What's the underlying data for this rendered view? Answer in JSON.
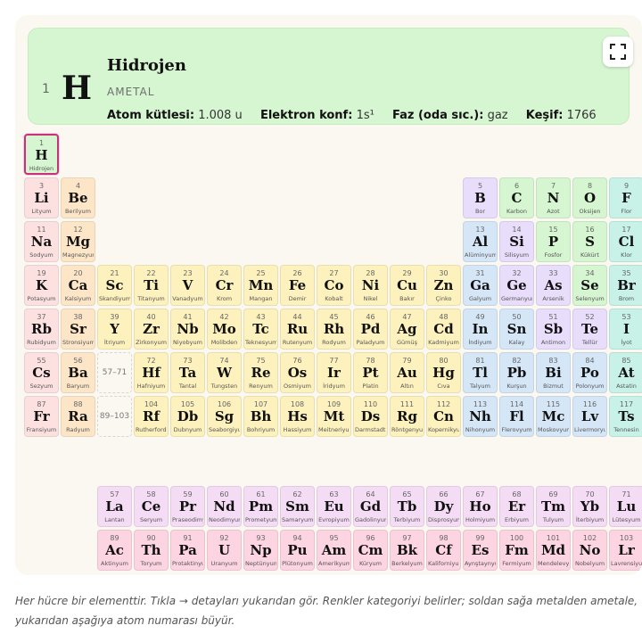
{
  "detail": {
    "number": "1",
    "symbol": "H",
    "name": "Hidrojen",
    "category": "AMETAL",
    "props": [
      {
        "label": "Atom kütlesi:",
        "value": "1.008 u"
      },
      {
        "label": "Elektron konf:",
        "value": "1s¹"
      },
      {
        "label": "Faz (oda sıc.):",
        "value": "gaz"
      },
      {
        "label": "Keşif:",
        "value": "1766"
      }
    ]
  },
  "colors": {
    "nonmetal": "#d6f5d1",
    "alkali": "#fde1e1",
    "alkaline": "#fde6c8",
    "transition": "#fdf1bd",
    "metalloid": "#e8ddfa",
    "post_transition": "#d5e6f7",
    "halogen": "#c8f2e8",
    "lanthanide": "#f5dcf5",
    "actinide": "#fcd4e2",
    "noble": "#ffe6c8"
  },
  "placeholders": {
    "lanthanides": "57–71",
    "actinides": "89–103"
  },
  "elements": [
    {
      "n": "1",
      "s": "H",
      "name": "Hidrojen",
      "cat": "nonmetal",
      "row": 1,
      "col": 1,
      "selected": true
    },
    {
      "n": "3",
      "s": "Li",
      "name": "Lityum",
      "cat": "alkali",
      "row": 2,
      "col": 1
    },
    {
      "n": "4",
      "s": "Be",
      "name": "Berilyum",
      "cat": "alkaline",
      "row": 2,
      "col": 2
    },
    {
      "n": "5",
      "s": "B",
      "name": "Bor",
      "cat": "metalloid",
      "row": 2,
      "col": 13
    },
    {
      "n": "6",
      "s": "C",
      "name": "Karbon",
      "cat": "nonmetal",
      "row": 2,
      "col": 14
    },
    {
      "n": "7",
      "s": "N",
      "name": "Azot",
      "cat": "nonmetal",
      "row": 2,
      "col": 15
    },
    {
      "n": "8",
      "s": "O",
      "name": "Oksijen",
      "cat": "nonmetal",
      "row": 2,
      "col": 16
    },
    {
      "n": "9",
      "s": "F",
      "name": "Flor",
      "cat": "halogen",
      "row": 2,
      "col": 17
    },
    {
      "n": "11",
      "s": "Na",
      "name": "Sodyum",
      "cat": "alkali",
      "row": 3,
      "col": 1
    },
    {
      "n": "12",
      "s": "Mg",
      "name": "Magnezyum",
      "cat": "alkaline",
      "row": 3,
      "col": 2
    },
    {
      "n": "13",
      "s": "Al",
      "name": "Alüminyum",
      "cat": "post_transition",
      "row": 3,
      "col": 13
    },
    {
      "n": "14",
      "s": "Si",
      "name": "Silisyum",
      "cat": "metalloid",
      "row": 3,
      "col": 14
    },
    {
      "n": "15",
      "s": "P",
      "name": "Fosfor",
      "cat": "nonmetal",
      "row": 3,
      "col": 15
    },
    {
      "n": "16",
      "s": "S",
      "name": "Kükürt",
      "cat": "nonmetal",
      "row": 3,
      "col": 16
    },
    {
      "n": "17",
      "s": "Cl",
      "name": "Klor",
      "cat": "halogen",
      "row": 3,
      "col": 17
    },
    {
      "n": "19",
      "s": "K",
      "name": "Potasyum",
      "cat": "alkali",
      "row": 4,
      "col": 1
    },
    {
      "n": "20",
      "s": "Ca",
      "name": "Kalsiyum",
      "cat": "alkaline",
      "row": 4,
      "col": 2
    },
    {
      "n": "21",
      "s": "Sc",
      "name": "Skandiyum",
      "cat": "transition",
      "row": 4,
      "col": 3
    },
    {
      "n": "22",
      "s": "Ti",
      "name": "Titanyum",
      "cat": "transition",
      "row": 4,
      "col": 4
    },
    {
      "n": "23",
      "s": "V",
      "name": "Vanadyum",
      "cat": "transition",
      "row": 4,
      "col": 5
    },
    {
      "n": "24",
      "s": "Cr",
      "name": "Krom",
      "cat": "transition",
      "row": 4,
      "col": 6
    },
    {
      "n": "25",
      "s": "Mn",
      "name": "Mangan",
      "cat": "transition",
      "row": 4,
      "col": 7
    },
    {
      "n": "26",
      "s": "Fe",
      "name": "Demir",
      "cat": "transition",
      "row": 4,
      "col": 8
    },
    {
      "n": "27",
      "s": "Co",
      "name": "Kobalt",
      "cat": "transition",
      "row": 4,
      "col": 9
    },
    {
      "n": "28",
      "s": "Ni",
      "name": "Nikel",
      "cat": "transition",
      "row": 4,
      "col": 10
    },
    {
      "n": "29",
      "s": "Cu",
      "name": "Bakır",
      "cat": "transition",
      "row": 4,
      "col": 11
    },
    {
      "n": "30",
      "s": "Zn",
      "name": "Çinko",
      "cat": "transition",
      "row": 4,
      "col": 12
    },
    {
      "n": "31",
      "s": "Ga",
      "name": "Galyum",
      "cat": "post_transition",
      "row": 4,
      "col": 13
    },
    {
      "n": "32",
      "s": "Ge",
      "name": "Germanyum",
      "cat": "metalloid",
      "row": 4,
      "col": 14
    },
    {
      "n": "33",
      "s": "As",
      "name": "Arsenik",
      "cat": "metalloid",
      "row": 4,
      "col": 15
    },
    {
      "n": "34",
      "s": "Se",
      "name": "Selenyum",
      "cat": "nonmetal",
      "row": 4,
      "col": 16
    },
    {
      "n": "35",
      "s": "Br",
      "name": "Brom",
      "cat": "halogen",
      "row": 4,
      "col": 17
    },
    {
      "n": "37",
      "s": "Rb",
      "name": "Rubidyum",
      "cat": "alkali",
      "row": 5,
      "col": 1
    },
    {
      "n": "38",
      "s": "Sr",
      "name": "Stronsiyum",
      "cat": "alkaline",
      "row": 5,
      "col": 2
    },
    {
      "n": "39",
      "s": "Y",
      "name": "İtriyum",
      "cat": "transition",
      "row": 5,
      "col": 3
    },
    {
      "n": "40",
      "s": "Zr",
      "name": "Zirkonyum",
      "cat": "transition",
      "row": 5,
      "col": 4
    },
    {
      "n": "41",
      "s": "Nb",
      "name": "Niyobyum",
      "cat": "transition",
      "row": 5,
      "col": 5
    },
    {
      "n": "42",
      "s": "Mo",
      "name": "Molibden",
      "cat": "transition",
      "row": 5,
      "col": 6
    },
    {
      "n": "43",
      "s": "Tc",
      "name": "Teknesyum",
      "cat": "transition",
      "row": 5,
      "col": 7
    },
    {
      "n": "44",
      "s": "Ru",
      "name": "Rutenyum",
      "cat": "transition",
      "row": 5,
      "col": 8
    },
    {
      "n": "45",
      "s": "Rh",
      "name": "Rodyum",
      "cat": "transition",
      "row": 5,
      "col": 9
    },
    {
      "n": "46",
      "s": "Pd",
      "name": "Paladyum",
      "cat": "transition",
      "row": 5,
      "col": 10
    },
    {
      "n": "47",
      "s": "Ag",
      "name": "Gümüş",
      "cat": "transition",
      "row": 5,
      "col": 11
    },
    {
      "n": "48",
      "s": "Cd",
      "name": "Kadmiyum",
      "cat": "transition",
      "row": 5,
      "col": 12
    },
    {
      "n": "49",
      "s": "In",
      "name": "İndiyum",
      "cat": "post_transition",
      "row": 5,
      "col": 13
    },
    {
      "n": "50",
      "s": "Sn",
      "name": "Kalay",
      "cat": "post_transition",
      "row": 5,
      "col": 14
    },
    {
      "n": "51",
      "s": "Sb",
      "name": "Antimon",
      "cat": "metalloid",
      "row": 5,
      "col": 15
    },
    {
      "n": "52",
      "s": "Te",
      "name": "Tellür",
      "cat": "metalloid",
      "row": 5,
      "col": 16
    },
    {
      "n": "53",
      "s": "I",
      "name": "İyot",
      "cat": "halogen",
      "row": 5,
      "col": 17
    },
    {
      "n": "55",
      "s": "Cs",
      "name": "Sezyum",
      "cat": "alkali",
      "row": 6,
      "col": 1
    },
    {
      "n": "56",
      "s": "Ba",
      "name": "Baryum",
      "cat": "alkaline",
      "row": 6,
      "col": 2
    },
    {
      "n": "72",
      "s": "Hf",
      "name": "Hafniyum",
      "cat": "transition",
      "row": 6,
      "col": 4
    },
    {
      "n": "73",
      "s": "Ta",
      "name": "Tantal",
      "cat": "transition",
      "row": 6,
      "col": 5
    },
    {
      "n": "74",
      "s": "W",
      "name": "Tungsten",
      "cat": "transition",
      "row": 6,
      "col": 6
    },
    {
      "n": "75",
      "s": "Re",
      "name": "Renyum",
      "cat": "transition",
      "row": 6,
      "col": 7
    },
    {
      "n": "76",
      "s": "Os",
      "name": "Osmiyum",
      "cat": "transition",
      "row": 6,
      "col": 8
    },
    {
      "n": "77",
      "s": "Ir",
      "name": "İridyum",
      "cat": "transition",
      "row": 6,
      "col": 9
    },
    {
      "n": "78",
      "s": "Pt",
      "name": "Platin",
      "cat": "transition",
      "row": 6,
      "col": 10
    },
    {
      "n": "79",
      "s": "Au",
      "name": "Altın",
      "cat": "transition",
      "row": 6,
      "col": 11
    },
    {
      "n": "80",
      "s": "Hg",
      "name": "Cıva",
      "cat": "transition",
      "row": 6,
      "col": 12
    },
    {
      "n": "81",
      "s": "Tl",
      "name": "Talyum",
      "cat": "post_transition",
      "row": 6,
      "col": 13
    },
    {
      "n": "82",
      "s": "Pb",
      "name": "Kurşun",
      "cat": "post_transition",
      "row": 6,
      "col": 14
    },
    {
      "n": "83",
      "s": "Bi",
      "name": "Bizmut",
      "cat": "post_transition",
      "row": 6,
      "col": 15
    },
    {
      "n": "84",
      "s": "Po",
      "name": "Polonyum",
      "cat": "post_transition",
      "row": 6,
      "col": 16
    },
    {
      "n": "85",
      "s": "At",
      "name": "Astatin",
      "cat": "halogen",
      "row": 6,
      "col": 17
    },
    {
      "n": "87",
      "s": "Fr",
      "name": "Fransiyum",
      "cat": "alkali",
      "row": 7,
      "col": 1
    },
    {
      "n": "88",
      "s": "Ra",
      "name": "Radyum",
      "cat": "alkaline",
      "row": 7,
      "col": 2
    },
    {
      "n": "104",
      "s": "Rf",
      "name": "Rutherfordiyum",
      "cat": "transition",
      "row": 7,
      "col": 4
    },
    {
      "n": "105",
      "s": "Db",
      "name": "Dubnyum",
      "cat": "transition",
      "row": 7,
      "col": 5
    },
    {
      "n": "106",
      "s": "Sg",
      "name": "Seaborgiyum",
      "cat": "transition",
      "row": 7,
      "col": 6
    },
    {
      "n": "107",
      "s": "Bh",
      "name": "Bohriyum",
      "cat": "transition",
      "row": 7,
      "col": 7
    },
    {
      "n": "108",
      "s": "Hs",
      "name": "Hassiyum",
      "cat": "transition",
      "row": 7,
      "col": 8
    },
    {
      "n": "109",
      "s": "Mt",
      "name": "Meitneriyum",
      "cat": "transition",
      "row": 7,
      "col": 9
    },
    {
      "n": "110",
      "s": "Ds",
      "name": "Darmstadtiyum",
      "cat": "transition",
      "row": 7,
      "col": 10
    },
    {
      "n": "111",
      "s": "Rg",
      "name": "Röntgenyum",
      "cat": "transition",
      "row": 7,
      "col": 11
    },
    {
      "n": "112",
      "s": "Cn",
      "name": "Kopernikyum",
      "cat": "transition",
      "row": 7,
      "col": 12
    },
    {
      "n": "113",
      "s": "Nh",
      "name": "Nihonyum",
      "cat": "post_transition",
      "row": 7,
      "col": 13
    },
    {
      "n": "114",
      "s": "Fl",
      "name": "Flerovyum",
      "cat": "post_transition",
      "row": 7,
      "col": 14
    },
    {
      "n": "115",
      "s": "Mc",
      "name": "Moskovyum",
      "cat": "post_transition",
      "row": 7,
      "col": 15
    },
    {
      "n": "116",
      "s": "Lv",
      "name": "Livermoryum",
      "cat": "post_transition",
      "row": 7,
      "col": 16
    },
    {
      "n": "117",
      "s": "Ts",
      "name": "Tennesin",
      "cat": "halogen",
      "row": 7,
      "col": 17
    },
    {
      "n": "57",
      "s": "La",
      "name": "Lantan",
      "cat": "lanthanide",
      "row": 9,
      "col": 3
    },
    {
      "n": "58",
      "s": "Ce",
      "name": "Seryum",
      "cat": "lanthanide",
      "row": 9,
      "col": 4
    },
    {
      "n": "59",
      "s": "Pr",
      "name": "Praseodimyum",
      "cat": "lanthanide",
      "row": 9,
      "col": 5
    },
    {
      "n": "60",
      "s": "Nd",
      "name": "Neodimyum",
      "cat": "lanthanide",
      "row": 9,
      "col": 6
    },
    {
      "n": "61",
      "s": "Pm",
      "name": "Prometyum",
      "cat": "lanthanide",
      "row": 9,
      "col": 7
    },
    {
      "n": "62",
      "s": "Sm",
      "name": "Samaryum",
      "cat": "lanthanide",
      "row": 9,
      "col": 8
    },
    {
      "n": "63",
      "s": "Eu",
      "name": "Evropiyum",
      "cat": "lanthanide",
      "row": 9,
      "col": 9
    },
    {
      "n": "64",
      "s": "Gd",
      "name": "Gadolinyum",
      "cat": "lanthanide",
      "row": 9,
      "col": 10
    },
    {
      "n": "65",
      "s": "Tb",
      "name": "Terbiyum",
      "cat": "lanthanide",
      "row": 9,
      "col": 11
    },
    {
      "n": "66",
      "s": "Dy",
      "name": "Disprosyum",
      "cat": "lanthanide",
      "row": 9,
      "col": 12
    },
    {
      "n": "67",
      "s": "Ho",
      "name": "Holmiyum",
      "cat": "lanthanide",
      "row": 9,
      "col": 13
    },
    {
      "n": "68",
      "s": "Er",
      "name": "Erbiyum",
      "cat": "lanthanide",
      "row": 9,
      "col": 14
    },
    {
      "n": "69",
      "s": "Tm",
      "name": "Tulyum",
      "cat": "lanthanide",
      "row": 9,
      "col": 15
    },
    {
      "n": "70",
      "s": "Yb",
      "name": "İterbiyum",
      "cat": "lanthanide",
      "row": 9,
      "col": 16
    },
    {
      "n": "71",
      "s": "Lu",
      "name": "Lütesyum",
      "cat": "lanthanide",
      "row": 9,
      "col": 17
    },
    {
      "n": "89",
      "s": "Ac",
      "name": "Aktinyum",
      "cat": "actinide",
      "row": 10,
      "col": 3
    },
    {
      "n": "90",
      "s": "Th",
      "name": "Toryum",
      "cat": "actinide",
      "row": 10,
      "col": 4
    },
    {
      "n": "91",
      "s": "Pa",
      "name": "Protaktinyum",
      "cat": "actinide",
      "row": 10,
      "col": 5
    },
    {
      "n": "92",
      "s": "U",
      "name": "Uranyum",
      "cat": "actinide",
      "row": 10,
      "col": 6
    },
    {
      "n": "93",
      "s": "Np",
      "name": "Neptünyum",
      "cat": "actinide",
      "row": 10,
      "col": 7
    },
    {
      "n": "94",
      "s": "Pu",
      "name": "Plütonyum",
      "cat": "actinide",
      "row": 10,
      "col": 8
    },
    {
      "n": "95",
      "s": "Am",
      "name": "Amerikyum",
      "cat": "actinide",
      "row": 10,
      "col": 9
    },
    {
      "n": "96",
      "s": "Cm",
      "name": "Küryum",
      "cat": "actinide",
      "row": 10,
      "col": 10
    },
    {
      "n": "97",
      "s": "Bk",
      "name": "Berkelyum",
      "cat": "actinide",
      "row": 10,
      "col": 11
    },
    {
      "n": "98",
      "s": "Cf",
      "name": "Kaliforniyum",
      "cat": "actinide",
      "row": 10,
      "col": 12
    },
    {
      "n": "99",
      "s": "Es",
      "name": "Aynştaynyum",
      "cat": "actinide",
      "row": 10,
      "col": 13
    },
    {
      "n": "100",
      "s": "Fm",
      "name": "Fermiyum",
      "cat": "actinide",
      "row": 10,
      "col": 14
    },
    {
      "n": "101",
      "s": "Md",
      "name": "Mendelevyum",
      "cat": "actinide",
      "row": 10,
      "col": 15
    },
    {
      "n": "102",
      "s": "No",
      "name": "Nobelyum",
      "cat": "actinide",
      "row": 10,
      "col": 16
    },
    {
      "n": "103",
      "s": "Lr",
      "name": "Lavrensiyum",
      "cat": "actinide",
      "row": 10,
      "col": 17
    }
  ],
  "caption": {
    "line1": "Her hücre bir elementtir. Tıkla → detayları yukarıdan gör. Renkler kategoriyi belirler; soldan sağa metalden ametale,",
    "line2": "yukarıdan aşağıya atom numarası büyür."
  }
}
